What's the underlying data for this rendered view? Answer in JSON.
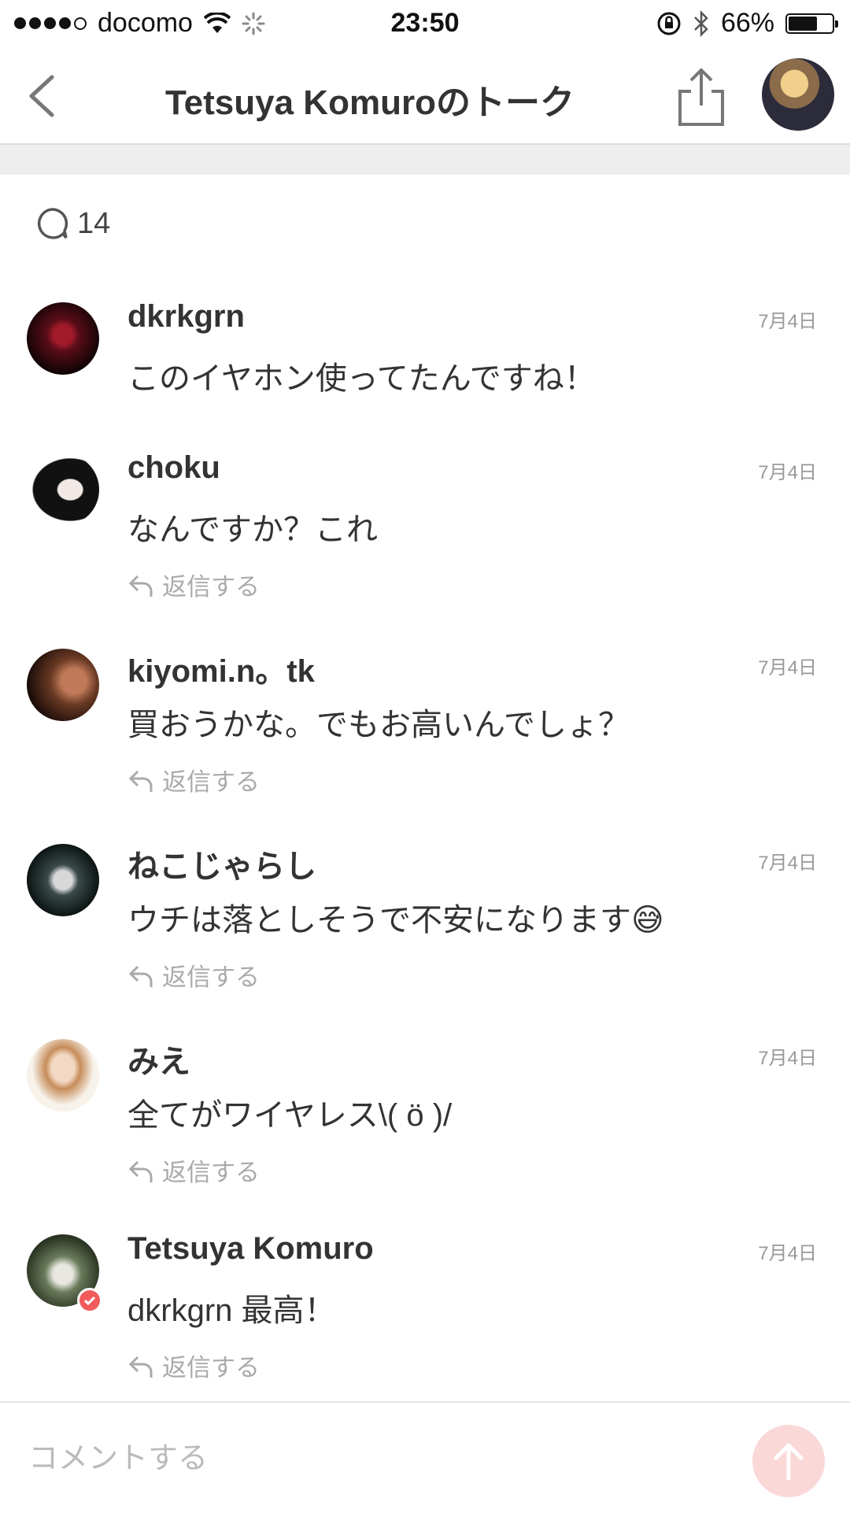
{
  "status_bar": {
    "carrier": "docomo",
    "time": "23:50",
    "battery_percent": "66%",
    "battery_level": 0.66,
    "signal_icon": "signal-dots-icon",
    "wifi_icon": "wifi-icon",
    "bluetooth_icon": "bluetooth-icon",
    "lock_icon": "rotation-lock-icon"
  },
  "header": {
    "title": "Tetsuya Komuroのトーク",
    "back_icon": "chevron-left-icon",
    "share_icon": "share-icon"
  },
  "comment_count": "14",
  "reply_label": "返信する",
  "comments": [
    {
      "name": "dkrkgrn",
      "date": "7月4日",
      "text": "このイヤホン使ってたんですね！",
      "has_reply": false
    },
    {
      "name": "choku",
      "date": "7月4日",
      "text": "なんですか？これ",
      "has_reply": true
    },
    {
      "name": "kiyomi.n。tk",
      "date": "7月4日",
      "text": "買おうかな。でもお高いんでしょ？",
      "has_reply": true
    },
    {
      "name": "ねこじゃらし",
      "date": "7月4日",
      "text": "ウチは落としそうで不安になります😅",
      "has_reply": true
    },
    {
      "name": "みえ",
      "date": "7月4日",
      "text": "全てがワイヤレス\\( ö )/",
      "has_reply": true
    },
    {
      "name": "Tetsuya Komuro",
      "date": "7月4日",
      "text": "dkrkgrn 最高！",
      "has_reply": true,
      "verified": true
    }
  ],
  "composer": {
    "placeholder": "コメントする",
    "send_icon": "arrow-up-icon"
  },
  "colors": {
    "accent": "#f15b5b",
    "send_button": "#fbd8d8"
  }
}
